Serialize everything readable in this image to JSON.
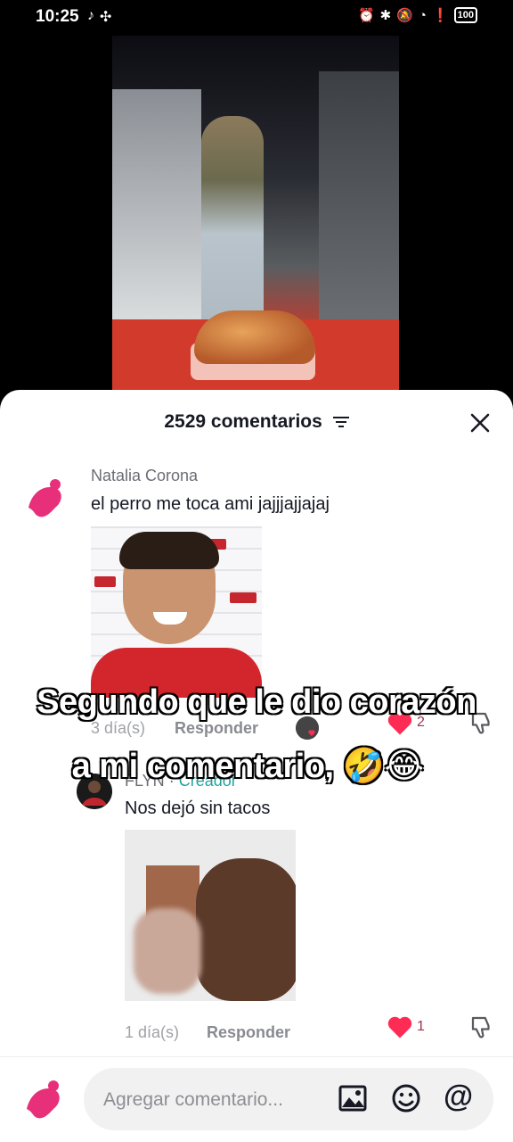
{
  "status_bar": {
    "time": "10:25",
    "battery": "100",
    "apps": [
      "tiktok-icon",
      "pinwheel-icon"
    ],
    "system_icons": [
      "alarm-icon",
      "bluetooth-icon",
      "mute-icon",
      "wifi-icon",
      "alert-icon",
      "battery-icon"
    ]
  },
  "sheet": {
    "title": "2529 comentarios",
    "close_icon": "close-icon",
    "sort_icon": "sort-icon"
  },
  "comments": [
    {
      "author": "Natalia Corona",
      "text": "el perro me toca ami jajjjajjajaj",
      "time": "3 día(s)",
      "reply_label": "Responder",
      "likes": "2",
      "has_sticker": true
    },
    {
      "author": "FLYN",
      "author_badge": "Creador",
      "text": "Nos dejó sin tacos",
      "time": "1 día(s)",
      "reply_label": "Responder",
      "likes": "1",
      "has_sticker": true
    }
  ],
  "overlay_caption": {
    "line1": "Segundo que le dio corazón",
    "line2": "a mi comentario, 🤣😂"
  },
  "composer": {
    "placeholder": "Agregar comentario...",
    "icons": [
      "image-icon",
      "emoji-icon",
      "mention-icon"
    ],
    "mention_symbol": "@"
  },
  "colors": {
    "accent_like": "#fe2c55",
    "creator_badge": "#20a39e",
    "avatar_pink": "#e8307a"
  }
}
